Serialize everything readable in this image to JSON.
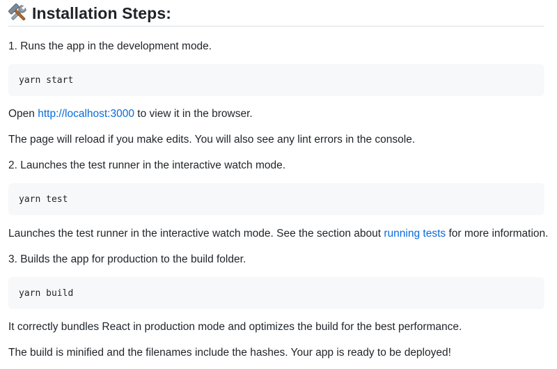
{
  "heading": {
    "icon": "hammer-and-wrench-icon",
    "title": "Installation Steps:"
  },
  "step1": {
    "label": "1. Runs the app in the development mode.",
    "command": "yarn start",
    "open_prefix": "Open ",
    "open_link": "http://localhost:3000",
    "open_suffix": " to view it in the browser.",
    "reload_note": "The page will reload if you make edits. You will also see any lint errors in the console."
  },
  "step2": {
    "label": "2. Launches the test runner in the interactive watch mode.",
    "command": "yarn test",
    "desc_prefix": "Launches the test runner in the interactive watch mode. See the section about ",
    "desc_link": "running tests",
    "desc_suffix": " for more information."
  },
  "step3": {
    "label": "3. Builds the app for production to the build folder.",
    "command": "yarn build",
    "bundle_note": "It correctly bundles React in production mode and optimizes the build for the best performance.",
    "minify_note": "The build is minified and the filenames include the hashes. Your app is ready to be deployed!"
  },
  "colors": {
    "link": "#0969da",
    "code_bg": "#f6f8fa",
    "text": "#1f2328"
  }
}
